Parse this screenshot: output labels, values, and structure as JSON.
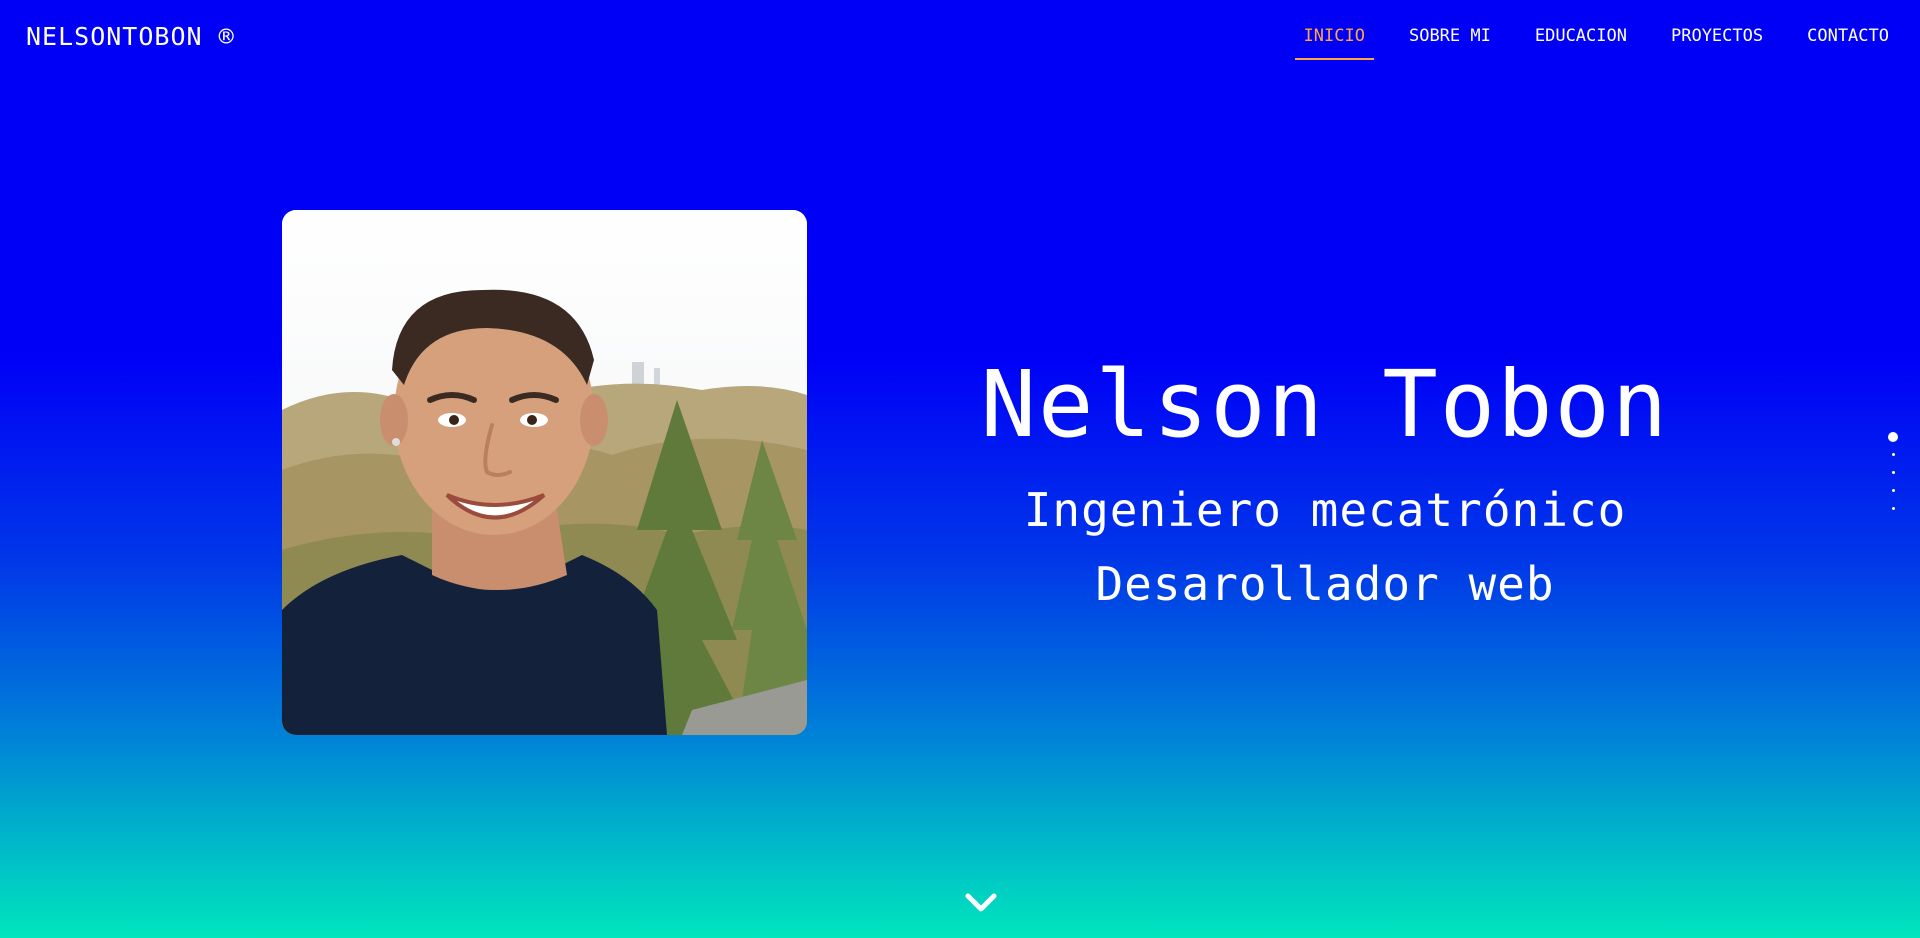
{
  "brand": {
    "name": "NELSONTOBON ®"
  },
  "nav": {
    "items": [
      {
        "label": "INICIO",
        "active": true
      },
      {
        "label": "SOBRE MI",
        "active": false
      },
      {
        "label": "EDUCACION",
        "active": false
      },
      {
        "label": "PROYECTOS",
        "active": false
      },
      {
        "label": "CONTACTO",
        "active": false
      }
    ]
  },
  "hero": {
    "name": "Nelson Tobon",
    "lines": [
      "Ingeniero mecatrónico",
      "Desarollador web"
    ],
    "photo_icon": "portrait-photo"
  },
  "side_nav": {
    "count": 5,
    "active_index": 0
  },
  "scroll_icon": "chevron-down-icon",
  "colors": {
    "accent": "#ffa640",
    "gradient_top": "#0000f7",
    "gradient_bottom": "#00e6bd",
    "text": "#ffffff"
  }
}
